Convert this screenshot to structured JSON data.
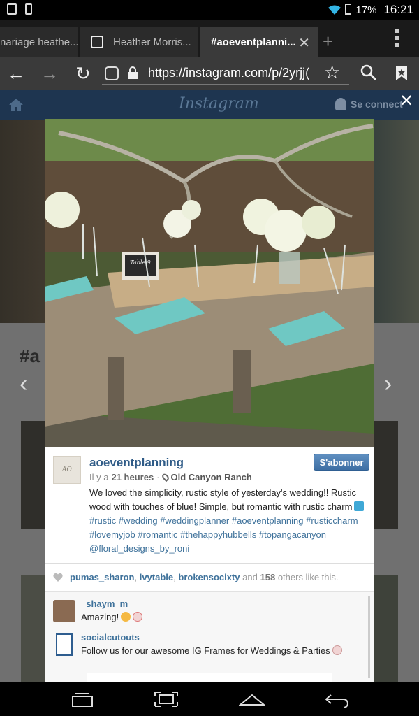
{
  "status_bar": {
    "battery": "17%",
    "time": "16:21"
  },
  "tabs": [
    {
      "label": "nariage heathe..."
    },
    {
      "label": "Heather Morris..."
    },
    {
      "label": "#aoeventplanni...",
      "active": true
    }
  ],
  "url_bar": {
    "url": "https://instagram.com/p/2yrjj("
  },
  "ig_header": {
    "logo": "Instagram",
    "login": "Se connect"
  },
  "background": {
    "hashtag": "#a"
  },
  "post": {
    "username": "aoeventplanning",
    "avatar_text": "AO",
    "follow_label": "S'abonner",
    "time_ago": "Il y a",
    "time_value": "21 heures",
    "separator": "·",
    "location": "Old Canyon Ranch",
    "caption_text": "We loved the simplicity, rustic style of yesterday's wedding!! Rustic wood with touches of blue! Simple, but romantic with rustic charm",
    "hashtags": [
      "#rustic",
      "#wedding",
      "#weddingplanner",
      "#aoeventplanning",
      "#rusticcharm",
      "#lovemyjob",
      "#romantic",
      "#thehappyhubbells",
      "#topangacanyon",
      "@floral_designs_by_roni"
    ],
    "table_card": "Table 9"
  },
  "likes": {
    "users": [
      "pumas_sharon",
      "lvytable",
      "brokensocixty"
    ],
    "and": "and",
    "count": "158",
    "suffix": "others like this."
  },
  "comments": [
    {
      "user": "_shaym_m",
      "text": "Amazing!"
    },
    {
      "user": "socialcutouts",
      "text": "Follow us for our awesome IG Frames for Weddings & Parties"
    }
  ],
  "colors": {
    "link": "#3f729b",
    "follow_button": "#4a7bb0",
    "ig_header": "#1e3550"
  },
  "icons": [
    "back-icon",
    "forward-icon",
    "reload-icon",
    "lock-icon",
    "star-icon",
    "search-icon",
    "bookmark-icon",
    "home-icon",
    "close-icon",
    "heart-icon",
    "location-pin-icon"
  ]
}
